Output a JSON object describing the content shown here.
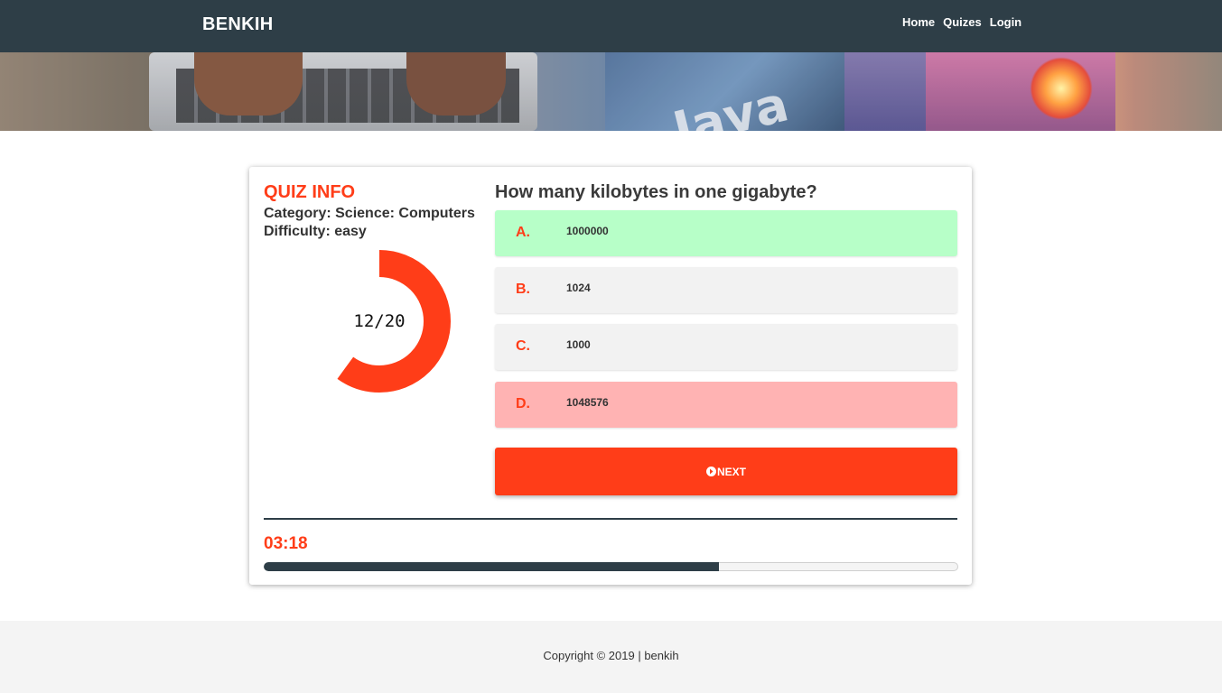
{
  "navbar": {
    "brand": "BENKIH",
    "links": [
      "Home",
      "Quizes",
      "Login"
    ]
  },
  "banner": {
    "book_title": "Java"
  },
  "quiz_info": {
    "title": "QUIZ INFO",
    "category": "Category: Science: Computers",
    "difficulty": "Difficulty: easy",
    "progress_text": "12/20",
    "answered": 12,
    "total": 20,
    "accent_color": "#ff3d18"
  },
  "question": {
    "text": "How many kilobytes in one gigabyte?",
    "answers": [
      {
        "letter": "A.",
        "text": "1000000",
        "state": "correct"
      },
      {
        "letter": "B.",
        "text": "1024",
        "state": "neutral"
      },
      {
        "letter": "C.",
        "text": "1000",
        "state": "neutral"
      },
      {
        "letter": "D.",
        "text": "1048576",
        "state": "wrong"
      }
    ],
    "next_label": "NEXT",
    "next_icon": "arrow-circle-right-icon"
  },
  "timer": {
    "text": "03:18",
    "progress_fraction": 0.655
  },
  "footer": {
    "copyright": "Copyright © 2019 | benkih"
  },
  "colors": {
    "navbar": "#2e3e47",
    "accent": "#ff3d18",
    "correct": "#b7ffc8",
    "wrong": "#ffb3b3"
  }
}
